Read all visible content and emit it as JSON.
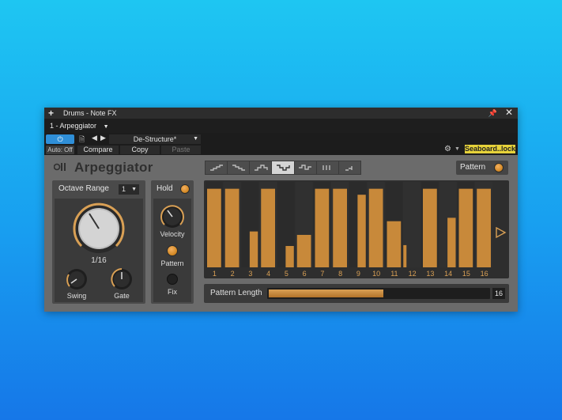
{
  "window": {
    "title": "Drums - Note FX",
    "preset_dropdown": "1 - Arpeggiator"
  },
  "controls": {
    "power_icon": "power-icon",
    "auto_label": "Auto: Off",
    "preset_name": "De-Structure*",
    "compare": "Compare",
    "copy": "Copy",
    "paste": "Paste",
    "device_tag": "Seaboard..lock",
    "device_tag_color": "#e6d23a"
  },
  "plugin": {
    "name": "Arpeggiator",
    "pattern_label": "Pattern",
    "accent_color": "#d38925",
    "shape_buttons": [
      {
        "icon": "up-pattern-icon",
        "selected": false
      },
      {
        "icon": "down-pattern-icon",
        "selected": false
      },
      {
        "icon": "up-down-pattern-icon",
        "selected": false
      },
      {
        "icon": "down-up-pattern-icon",
        "selected": true
      },
      {
        "icon": "random-pattern-icon",
        "selected": false
      },
      {
        "icon": "chord-pattern-icon",
        "selected": false
      },
      {
        "icon": "as-played-pattern-icon",
        "selected": false
      }
    ]
  },
  "left_panel": {
    "octave_range_label": "Octave Range",
    "octave_range_value": "1",
    "rate_value": "1/16",
    "swing_label": "Swing",
    "gate_label": "Gate"
  },
  "middle_panel": {
    "hold_label": "Hold",
    "velocity_label": "Velocity",
    "pattern_label": "Pattern",
    "fix_label": "Fix"
  },
  "steps": {
    "count": 16,
    "labels": [
      "1",
      "2",
      "3",
      "4",
      "5",
      "6",
      "7",
      "8",
      "9",
      "10",
      "11",
      "12",
      "13",
      "14",
      "15",
      "16"
    ],
    "main_levels": [
      0.92,
      0.92,
      0,
      0.92,
      0,
      0,
      0.92,
      0.92,
      0,
      0.92,
      0,
      0,
      0.92,
      0,
      0.92,
      0.92
    ],
    "sub_levels": [
      0,
      0,
      0.42,
      0,
      0.25,
      0.38,
      0,
      0,
      0.85,
      0,
      0.54,
      0.26,
      0,
      0.58,
      0,
      0
    ],
    "play_icon": "play-triangle-icon"
  },
  "pattern_length": {
    "label": "Pattern Length",
    "value": "16",
    "fill_fraction": 0.52
  }
}
